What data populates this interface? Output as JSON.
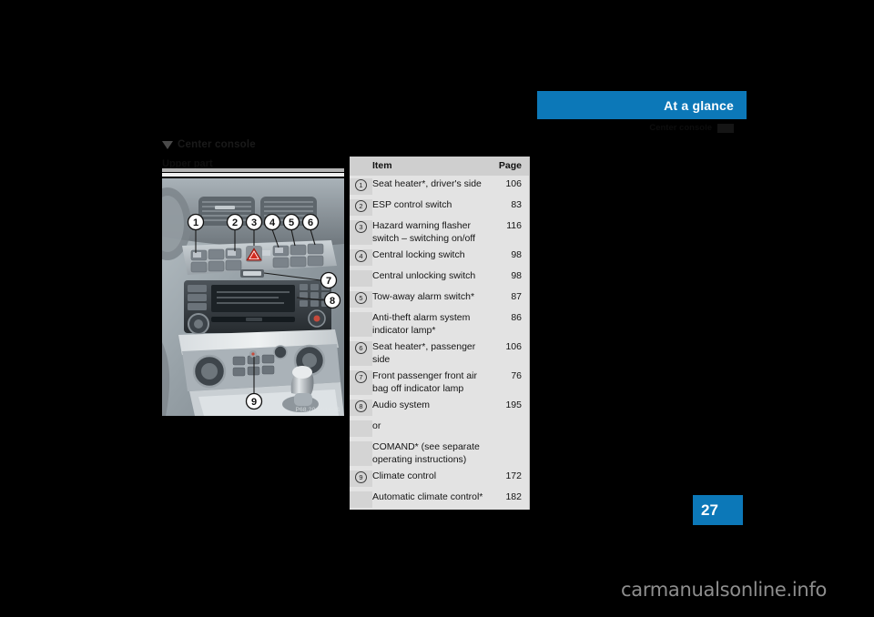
{
  "header": {
    "title": "At a glance",
    "subtitle": "Center console",
    "page_marker": ""
  },
  "section": {
    "heading": "Center console",
    "subheading": "Upper part"
  },
  "figure": {
    "credit": "P68.20-3016-31",
    "callouts": [
      "1",
      "2",
      "3",
      "4",
      "5",
      "6",
      "7",
      "8",
      "9"
    ]
  },
  "table": {
    "columns": {
      "number": "",
      "item": "Item",
      "page": "Page"
    },
    "rows": [
      {
        "num": "1",
        "item": "Seat heater*, driver's side",
        "page": "106"
      },
      {
        "num": "2",
        "item": "ESP control switch",
        "page": "83"
      },
      {
        "num": "3",
        "item": "Hazard warning flasher switch – switching on/off",
        "page": "116"
      },
      {
        "num": "4",
        "item": "Central locking switch",
        "page": "98"
      },
      {
        "num": "",
        "item": "Central unlocking switch",
        "page": "98"
      },
      {
        "num": "5",
        "item": "Tow-away alarm switch*",
        "page": "87"
      },
      {
        "num": "",
        "item": "Anti-theft alarm system indicator lamp*",
        "page": "86"
      },
      {
        "num": "6",
        "item": "Seat heater*, passenger side",
        "page": "106"
      },
      {
        "num": "7",
        "item": "Front passenger front air bag off indicator lamp",
        "page": "76"
      },
      {
        "num": "8",
        "item": "Audio system",
        "page": "195"
      },
      {
        "num": "",
        "item": "or",
        "page": ""
      },
      {
        "num": "",
        "item": "COMAND* (see separate operating instructions)",
        "page": ""
      },
      {
        "num": "9",
        "item": "Climate control",
        "page": "172"
      },
      {
        "num": "",
        "item": "Automatic climate control*",
        "page": "182"
      }
    ]
  },
  "footer": {
    "page_number": "27",
    "watermark": "carmanualsonline.info"
  },
  "colors": {
    "accent_blue": "#0c78b8",
    "table_bg": "#e3e3e3",
    "table_header_bg": "#cfcfcf",
    "number_column_bg": "#d4d4d4"
  }
}
